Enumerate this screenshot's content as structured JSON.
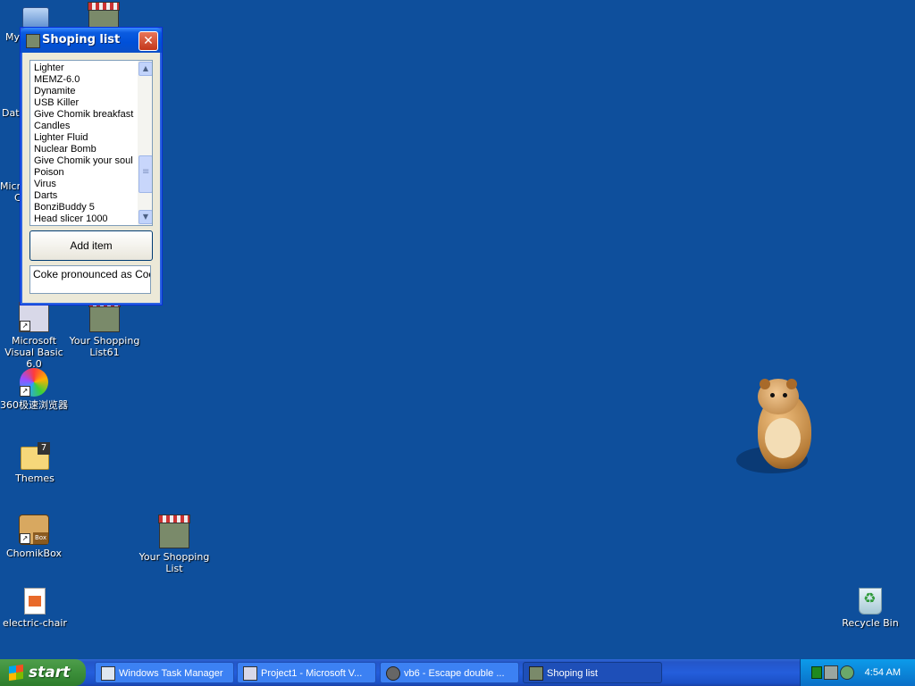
{
  "desktop": {
    "icons": {
      "my_computer": "My",
      "shop_top": "",
      "data": "Dat",
      "microsoft": "Micr",
      "microsoft_line2": "C",
      "vb6": "Microsoft Visual Basic 6.0",
      "shopping61": "Your Shopping List61",
      "browser360": "360极速浏览器",
      "themes": "Themes",
      "chomikbox": "ChomikBox",
      "shopping": "Your Shopping List",
      "electric_chair": "electric-chair",
      "recycle_bin": "Recycle Bin"
    }
  },
  "window": {
    "title": "Shoping list",
    "close_label": "✕",
    "list_items": [
      "Lighter",
      "MEMZ-6.0",
      "Dynamite",
      "USB Killer",
      "Give Chomik breakfast",
      "Candles",
      "Lighter Fluid",
      "Nuclear Bomb",
      "Give Chomik your soul",
      "Poison",
      "Virus",
      "Darts",
      "BonziBuddy 5",
      "Head slicer 1000"
    ],
    "scroll_up": "▲",
    "scroll_down": "▼",
    "add_button": "Add item",
    "text_value": "Coke pronounced as Cock"
  },
  "taskbar": {
    "start_label": "start",
    "buttons": [
      "Windows Task Manager",
      "Project1 - Microsoft V...",
      "vb6 - Escape double ...",
      "Shoping list"
    ],
    "clock": "4:54 AM"
  }
}
